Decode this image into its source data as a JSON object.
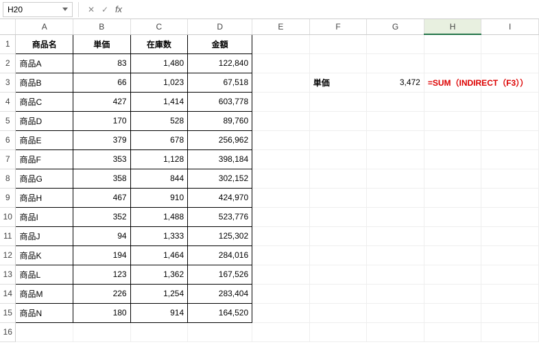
{
  "nameBox": "H20",
  "formulaBarValue": "",
  "columns": [
    "A",
    "B",
    "C",
    "D",
    "E",
    "F",
    "G",
    "H",
    "I"
  ],
  "rowNumbers": [
    1,
    2,
    3,
    4,
    5,
    6,
    7,
    8,
    9,
    10,
    11,
    12,
    13,
    14,
    15,
    16
  ],
  "headers": {
    "A": "商品名",
    "B": "単価",
    "C": "在庫数",
    "D": "金額"
  },
  "products": [
    {
      "name": "商品A",
      "price": "83",
      "stock": "1,480",
      "amount": "122,840"
    },
    {
      "name": "商品B",
      "price": "66",
      "stock": "1,023",
      "amount": "67,518"
    },
    {
      "name": "商品C",
      "price": "427",
      "stock": "1,414",
      "amount": "603,778"
    },
    {
      "name": "商品D",
      "price": "170",
      "stock": "528",
      "amount": "89,760"
    },
    {
      "name": "商品E",
      "price": "379",
      "stock": "678",
      "amount": "256,962"
    },
    {
      "name": "商品F",
      "price": "353",
      "stock": "1,128",
      "amount": "398,184"
    },
    {
      "name": "商品G",
      "price": "358",
      "stock": "844",
      "amount": "302,152"
    },
    {
      "name": "商品H",
      "price": "467",
      "stock": "910",
      "amount": "424,970"
    },
    {
      "name": "商品I",
      "price": "352",
      "stock": "1,488",
      "amount": "523,776"
    },
    {
      "name": "商品J",
      "price": "94",
      "stock": "1,333",
      "amount": "125,302"
    },
    {
      "name": "商品K",
      "price": "194",
      "stock": "1,464",
      "amount": "284,016"
    },
    {
      "name": "商品L",
      "price": "123",
      "stock": "1,362",
      "amount": "167,526"
    },
    {
      "name": "商品M",
      "price": "226",
      "stock": "1,254",
      "amount": "283,404"
    },
    {
      "name": "商品N",
      "price": "180",
      "stock": "914",
      "amount": "164,520"
    }
  ],
  "lookup": {
    "label": "単価",
    "result": "3,472",
    "formulaText": "=SUM（INDIRECT（F3））"
  }
}
